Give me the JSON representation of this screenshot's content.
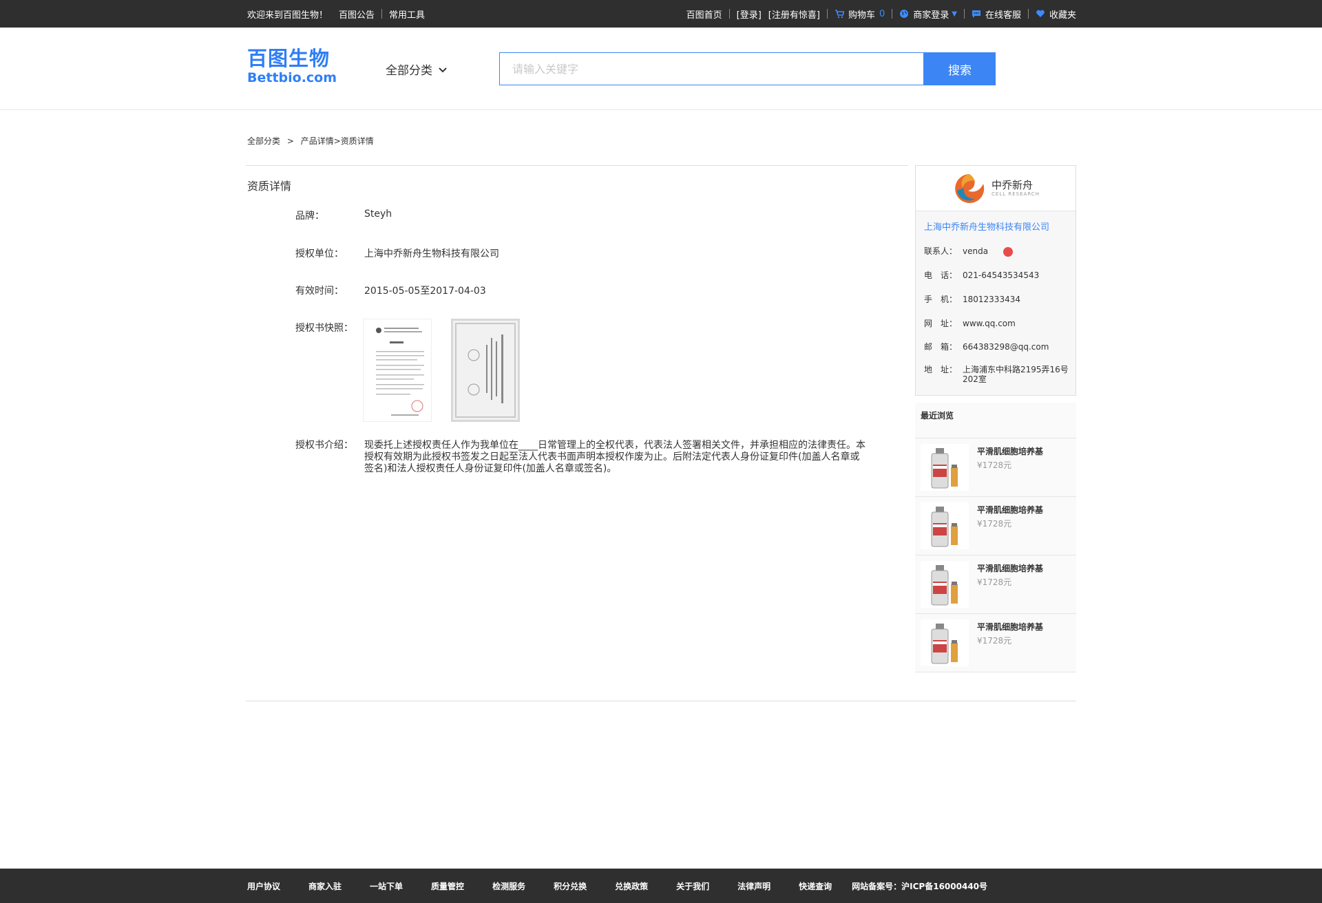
{
  "topbar": {
    "welcome": "欢迎来到百图生物！",
    "notice": "百图公告",
    "tools": "常用工具",
    "home": "百图首页",
    "login": "[登录]",
    "register": "[注册有惊喜]",
    "cart": "购物车",
    "cart_count": "0",
    "merchant_login": "商家登录",
    "service": "在线客服",
    "favorites": "收藏夹"
  },
  "header": {
    "logo_cn": "百图生物",
    "logo_en": "Bettbio.com",
    "category": "全部分类",
    "search_placeholder": "请输入关键字",
    "search_button": "搜索"
  },
  "breadcrumb": {
    "root": "全部分类",
    "sep": ">",
    "path": "产品详情>资质详情"
  },
  "detail": {
    "title": "资质详情",
    "brand_label": "品牌：",
    "brand_value": "Steyh",
    "unit_label": "授权单位：",
    "unit_value": "上海中乔新舟生物科技有限公司",
    "valid_label": "有效时间：",
    "valid_value": "2015-05-05至2017-04-03",
    "snapshot_label": "授权书快照：",
    "intro_label": "授权书介绍：",
    "intro_value": "现委托上述授权责任人作为我单位在____日常管理上的全权代表，代表法人签署相关文件，并承担相应的法律责任。本授权有效期为此授权书签发之日起至法人代表书面声明本授权作废为止。后附法定代表人身份证复印件(加盖人名章或签名)和法人授权责任人身份证复印件(加盖人名章或签名)。"
  },
  "company": {
    "logo_name": "中乔新舟",
    "logo_sub": "CELL RESEARCH",
    "name": "上海中乔新舟生物科技有限公司",
    "contact_label": "联系人：",
    "contact_value": "venda",
    "phone_label": "电　话：",
    "phone_value": "021-64543534543",
    "mobile_label": "手　机：",
    "mobile_value": "18012333434",
    "web_label": "网　址：",
    "web_value": "www.qq.com",
    "email_label": "邮　箱：",
    "email_value": "664383298@qq.com",
    "addr_label": "地　址：",
    "addr_value": "上海浦东中科路2195弄16号202室"
  },
  "recent": {
    "title": "最近浏览",
    "items": [
      {
        "name": "平滑肌细胞培养基",
        "price": "¥1728元"
      },
      {
        "name": "平滑肌细胞培养基",
        "price": "¥1728元"
      },
      {
        "name": "平滑肌细胞培养基",
        "price": "¥1728元"
      },
      {
        "name": "平滑肌细胞培养基",
        "price": "¥1728元"
      }
    ]
  },
  "footer": {
    "links": [
      "用户协议",
      "商家入驻",
      "一站下单",
      "质量管控",
      "检测服务",
      "积分兑换",
      "兑换政策",
      "关于我们",
      "法律声明",
      "快递查询"
    ],
    "icp": "网站备案号：沪ICP备16000440号"
  },
  "colors": {
    "accent": "#3c85f5",
    "topbar_bg": "#2f2f2f"
  }
}
